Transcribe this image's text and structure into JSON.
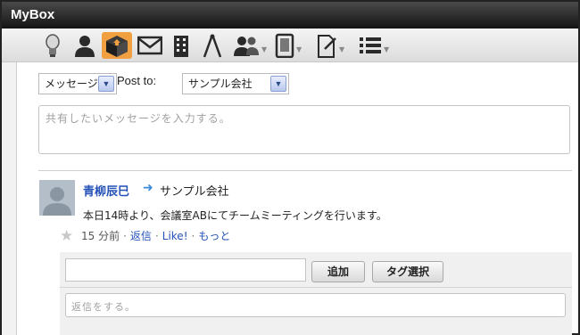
{
  "window": {
    "title": "MyBox"
  },
  "toolbar": {
    "icons": [
      "lightbulb-icon",
      "person-icon",
      "box-icon",
      "mail-icon",
      "building-icon",
      "compass-icon",
      "users-icon",
      "tablet-icon",
      "document-pin-icon",
      "list-icon"
    ],
    "active": "box-icon",
    "active_color": "#f0a040"
  },
  "composer": {
    "type_select": "メッセージ",
    "post_to_label": "Post to:",
    "target_select": "サンプル会社",
    "message_placeholder": "共有したいメッセージを入力する。"
  },
  "post": {
    "author": "青柳辰巳",
    "group": "サンプル会社",
    "body": "本日14時より、会議室ABにてチームミーティングを行います。",
    "time": "15 分前",
    "reply_link": "返信",
    "like_link": "Like!",
    "more_link": "もっと",
    "sep": "·"
  },
  "reply": {
    "add_button": "追加",
    "tag_button": "タグ選択",
    "reply_placeholder": "返信をする。"
  },
  "colors": {
    "link": "#2452b8",
    "titlebar": "#1e1e1e"
  }
}
